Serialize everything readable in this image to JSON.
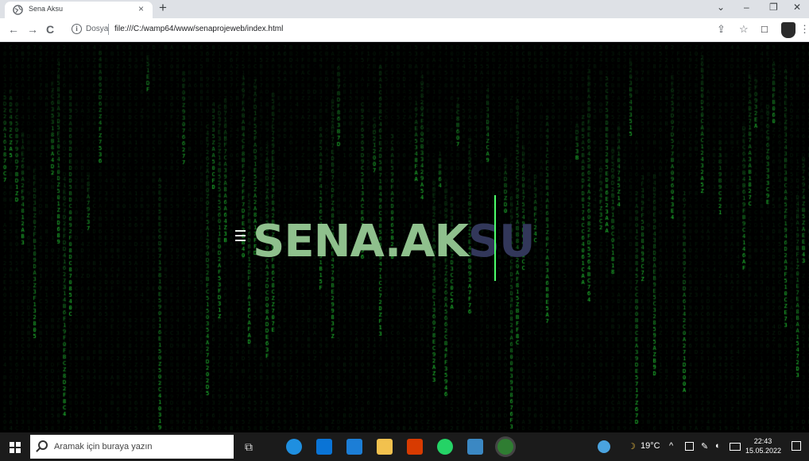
{
  "browser": {
    "tab_title": "Sena Aksu",
    "tab_close": "×",
    "new_tab": "+",
    "window_controls": {
      "minimize": "–",
      "restore": "❐",
      "close": "✕",
      "tab_search": "⌄"
    },
    "scheme_label": "Dosya",
    "url": "file:///C:/wamp64/www/senaprojeweb/index.html",
    "nav": {
      "back": "←",
      "forward": "→",
      "reload": "C"
    },
    "toolbar_icons": {
      "share": "⇪",
      "bookmark": "☆",
      "sidebar": "□",
      "menu": "⋮"
    }
  },
  "page": {
    "hero_typed": "SENA.AK",
    "hero_faded": "SU",
    "menu_icon": "hamburger-icon",
    "colors": {
      "background": "#000000",
      "rain": "#1fbf3a",
      "hero": "#8fc08d",
      "hero_faded": "#32375a",
      "cursor": "#4cff6a"
    }
  },
  "taskbar": {
    "search_placeholder": "Aramak için buraya yazın",
    "weather": "19°C",
    "tray_arrow": "^",
    "time": "22:43",
    "date": "15.05.2022",
    "apps": [
      {
        "name": "edge",
        "color": "#1f8fe0"
      },
      {
        "name": "store",
        "color": "#0a74d6"
      },
      {
        "name": "mail",
        "color": "#1c7ed6"
      },
      {
        "name": "explorer",
        "color": "#f2c14e"
      },
      {
        "name": "office",
        "color": "#d83b01"
      },
      {
        "name": "whatsapp",
        "color": "#25d366"
      },
      {
        "name": "photos",
        "color": "#3b88c3"
      },
      {
        "name": "chrome",
        "color": "#2f7d32"
      }
    ]
  }
}
